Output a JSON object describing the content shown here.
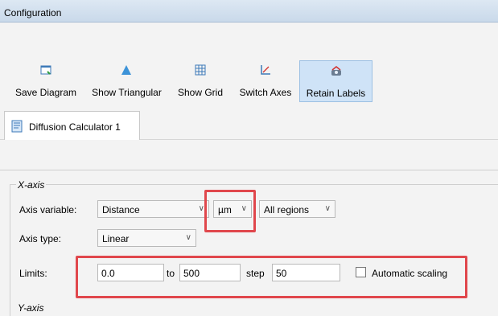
{
  "window": {
    "title": "Configuration"
  },
  "toolbar": {
    "buttons": [
      {
        "label": "Save Diagram",
        "icon": "save-diagram-icon"
      },
      {
        "label": "Show Triangular",
        "icon": "triangle-icon"
      },
      {
        "label": "Show Grid",
        "icon": "grid-icon"
      },
      {
        "label": "Switch Axes",
        "icon": "switch-axes-icon"
      },
      {
        "label": "Retain Labels",
        "icon": "retain-labels-icon",
        "active": true
      }
    ]
  },
  "tabs": [
    {
      "label": "Diffusion Calculator 1",
      "icon": "document-icon"
    }
  ],
  "xaxis": {
    "section_title": "X-axis",
    "axis_variable_label": "Axis variable:",
    "axis_variable_value": "Distance",
    "unit_value": "µm",
    "region_value": "All regions",
    "axis_type_label": "Axis type:",
    "axis_type_value": "Linear",
    "limits_label": "Limits:",
    "limit_from": "0.0",
    "to_label": "to",
    "limit_to": "500",
    "step_label": "step",
    "step_value": "50",
    "auto_scaling_label": "Automatic scaling",
    "auto_scaling_checked": false
  },
  "yaxis": {
    "section_title": "Y-axis"
  },
  "colors": {
    "highlight": "#e0474c",
    "accent": "#3d7ab8"
  }
}
